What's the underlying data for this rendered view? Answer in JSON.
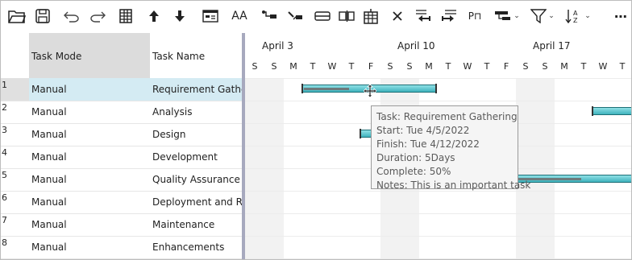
{
  "toolbar": {
    "items": [
      {
        "icon": "open-folder-icon"
      },
      {
        "icon": "save-icon"
      },
      {
        "icon": "undo-icon"
      },
      {
        "icon": "redo-icon"
      },
      {
        "icon": "grid-columns-icon"
      },
      {
        "icon": "move-up-icon"
      },
      {
        "icon": "move-down-icon"
      },
      {
        "icon": "task-information-icon"
      },
      {
        "icon": "font-size-icon",
        "label": "AA"
      },
      {
        "icon": "link-tasks-icon"
      },
      {
        "icon": "unlink-tasks-icon"
      },
      {
        "icon": "split-task-icon"
      },
      {
        "icon": "split-columns-icon"
      },
      {
        "icon": "calendar-grid-icon"
      },
      {
        "icon": "delete-icon"
      },
      {
        "icon": "outdent-icon"
      },
      {
        "icon": "indent-icon"
      },
      {
        "icon": "milestone-icon",
        "label": "P⊓"
      },
      {
        "icon": "critical-path-icon"
      },
      {
        "icon": "filter-icon"
      },
      {
        "icon": "sort-az-icon"
      },
      {
        "icon": "more-icon",
        "label": "⋯"
      }
    ]
  },
  "grid": {
    "columns": [
      "Task Mode",
      "Task Name"
    ],
    "rows": [
      {
        "num": "1",
        "mode": "Manual",
        "name": "Requirement Gathering"
      },
      {
        "num": "2",
        "mode": "Manual",
        "name": "Analysis"
      },
      {
        "num": "3",
        "mode": "Manual",
        "name": "Design"
      },
      {
        "num": "4",
        "mode": "Manual",
        "name": "Development"
      },
      {
        "num": "5",
        "mode": "Manual",
        "name": "Quality Assurance"
      },
      {
        "num": "6",
        "mode": "Manual",
        "name": "Deployment and Release"
      },
      {
        "num": "7",
        "mode": "Manual",
        "name": "Maintenance"
      },
      {
        "num": "8",
        "mode": "Manual",
        "name": "Enhancements"
      }
    ],
    "selected_row": "1"
  },
  "timeline": {
    "weeks": [
      "April 3",
      "April 10",
      "April 17"
    ],
    "days": [
      "S",
      "S",
      "M",
      "T",
      "W",
      "T",
      "F",
      "S",
      "S",
      "M",
      "T",
      "W",
      "T",
      "F",
      "S",
      "S",
      "M",
      "T",
      "W",
      "T"
    ]
  },
  "tooltip": {
    "task": "Task: Requirement Gathering",
    "start": "Start: Tue 4/5/2022",
    "finish": "Finish: Tue 4/12/2022",
    "duration": "Duration: 5Days",
    "complete": "Complete: 50%",
    "notes": "Notes: This is an important task"
  },
  "colors": {
    "bar": "#4fc3cc",
    "selection": "#d4ebf3",
    "splitter": "#a7a9be"
  }
}
